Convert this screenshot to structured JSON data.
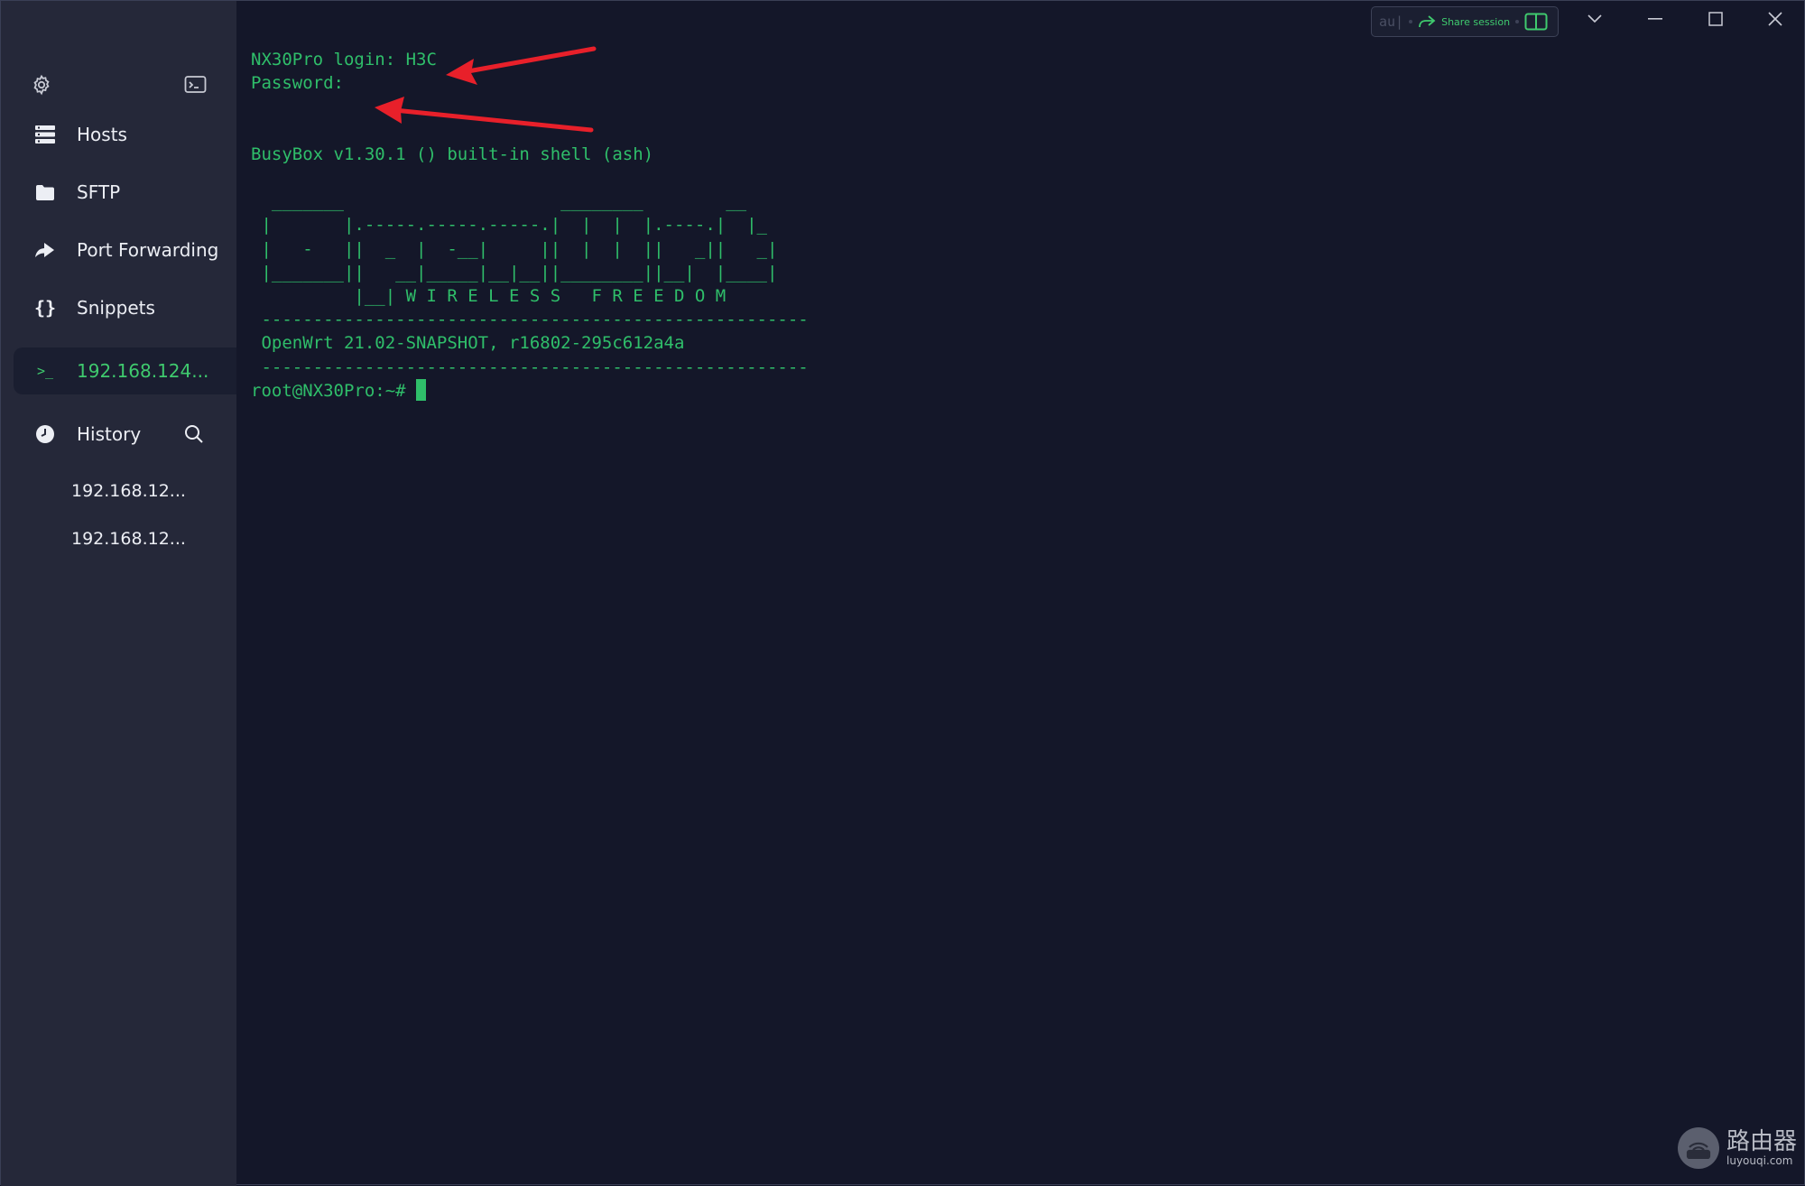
{
  "sidebar": {
    "items": [
      {
        "label": "Hosts",
        "icon": "hosts-icon"
      },
      {
        "label": "SFTP",
        "icon": "folder-icon"
      },
      {
        "label": "Port Forwarding",
        "icon": "port-forwarding-icon"
      },
      {
        "label": "Snippets",
        "icon": "snippets-icon"
      }
    ],
    "active_session": {
      "label": "192.168.124...",
      "icon": "terminal-prompt-icon"
    },
    "history": {
      "label": "History",
      "items": [
        "192.168.12...",
        "192.168.12..."
      ]
    }
  },
  "topbar": {
    "input_text": "au|",
    "share_label": "Share session"
  },
  "terminal": {
    "lines": [
      "NX30Pro login: H3C",
      "Password:",
      "",
      "",
      "BusyBox v1.30.1 () built-in shell (ash)",
      "",
      "  _______                     ________        __",
      " |       |.-----.-----.-----.|  |  |  |.----.|  |_",
      " |   -   ||  _  |  -__|     ||  |  |  ||   _||   _|",
      " |_______||   __|_____|__|__||________||__|  |____|",
      "          |__| W I R E L E S S   F R E E D O M",
      " -----------------------------------------------------",
      " OpenWrt 21.02-SNAPSHOT, r16802-295c612a4a",
      " -----------------------------------------------------"
    ],
    "prompt": "root@NX30Pro:~# "
  },
  "colors": {
    "terminal_bg": "#141729",
    "sidebar_bg": "#252839",
    "accent_green": "#2fbe6a",
    "annotation_red": "#e8202a"
  },
  "watermark": {
    "title": "路由器",
    "subtitle": "luyouqi.com"
  }
}
